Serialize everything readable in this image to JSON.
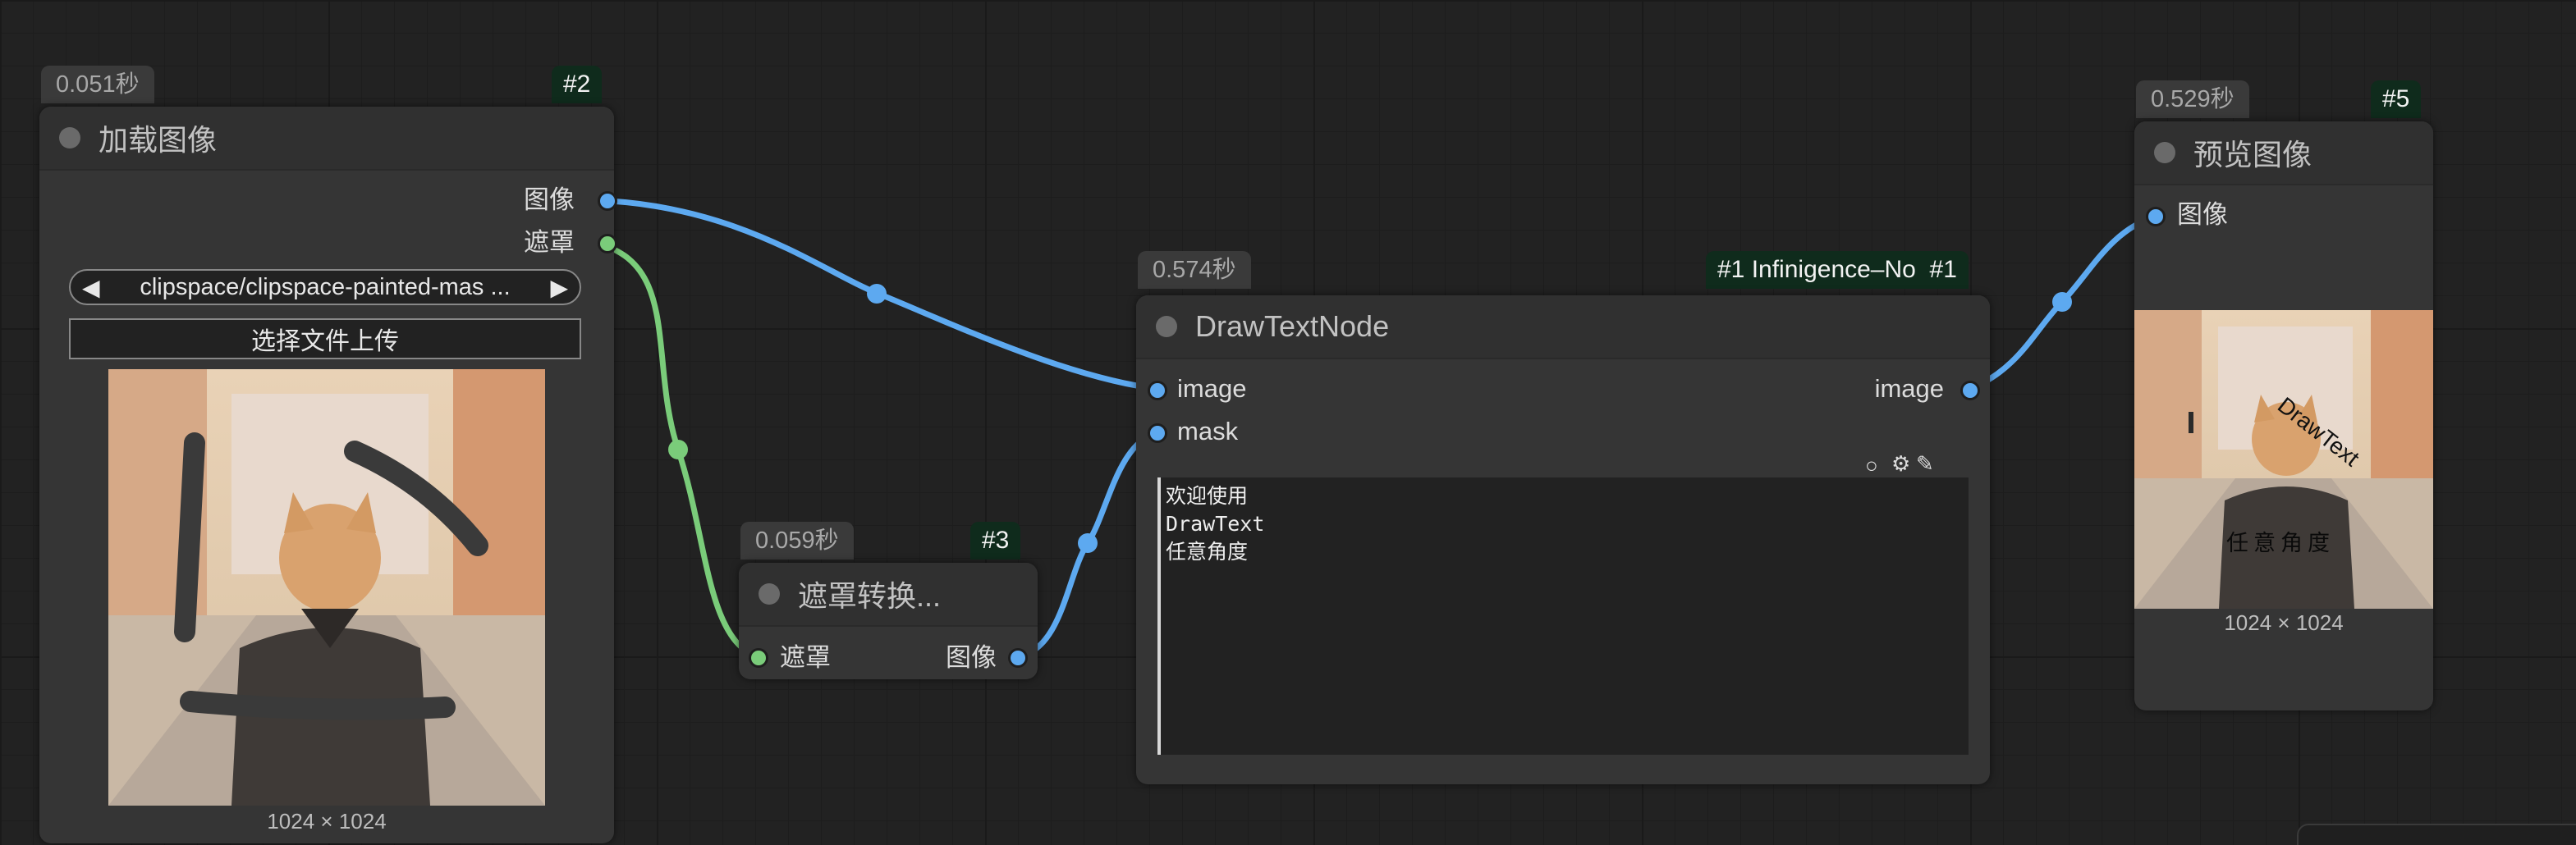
{
  "nodes": {
    "load_image": {
      "time": "0.051秒",
      "id": "#2",
      "title": "加载图像",
      "outputs": [
        "图像",
        "遮罩"
      ],
      "combo_value": "clipspace/clipspace-painted-mas ...",
      "upload_label": "选择文件上传",
      "image_size": "1024 × 1024"
    },
    "mask_convert": {
      "time": "0.059秒",
      "id": "#3",
      "title": "遮罩转换...",
      "input": "遮罩",
      "output": "图像"
    },
    "draw_text": {
      "time": "0.574秒",
      "id": "#1 Infinigence–No  #1",
      "title": "DrawTextNode",
      "inputs": [
        "image",
        "mask"
      ],
      "output": "image",
      "text_lines": [
        "欢迎使用",
        "DrawText",
        "任意角度"
      ]
    },
    "preview": {
      "time": "0.529秒",
      "id": "#5",
      "title": "预览图像",
      "input": "图像",
      "overlay_text_1": "DrawText",
      "overlay_text_2": "任意角度",
      "image_size": "1024 × 1024"
    }
  },
  "colors": {
    "image_link": "#5da9f0",
    "mask_link": "#7acc7a",
    "background": "#222222",
    "node_body": "#353535",
    "id_badge": "#0f2b1c"
  },
  "icons": {
    "combo_prev": "triangle-left",
    "combo_next": "triangle-right",
    "tool_circle": "circle-outline",
    "tool_gear": "gear",
    "tool_brush": "brush"
  }
}
